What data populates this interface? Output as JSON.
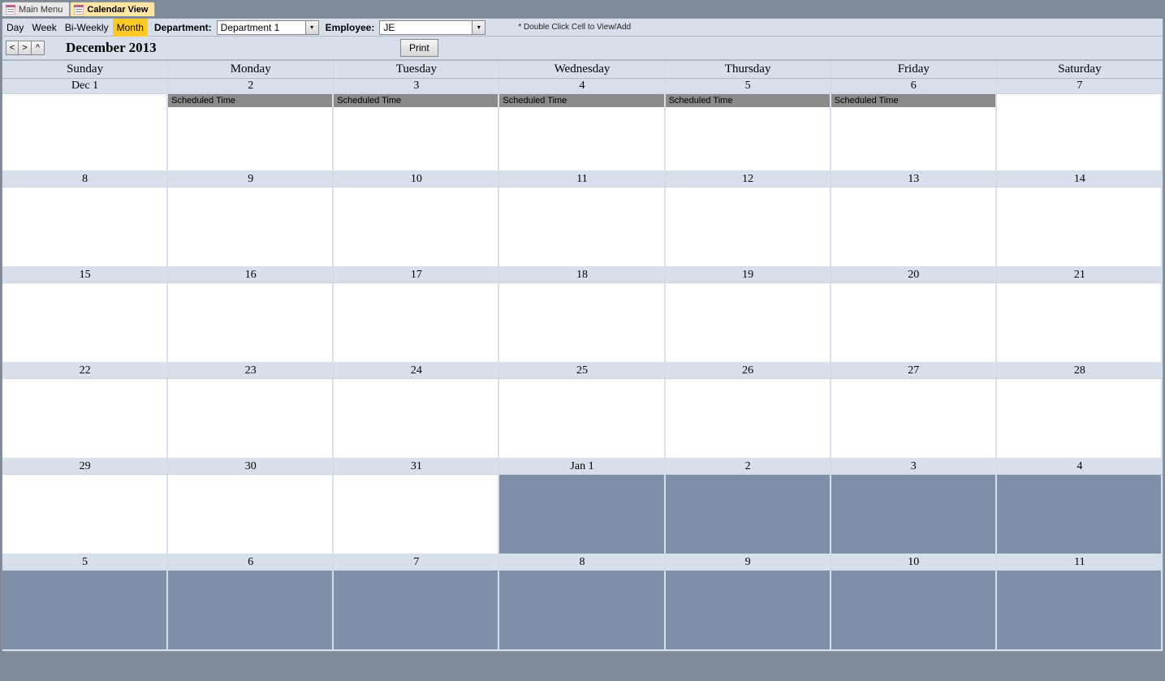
{
  "tabs": [
    {
      "label": "Main Menu",
      "active": false
    },
    {
      "label": "Calendar View",
      "active": true
    }
  ],
  "toolbar": {
    "views": [
      {
        "label": "Day",
        "active": false
      },
      {
        "label": "Week",
        "active": false
      },
      {
        "label": "Bi-Weekly",
        "active": false
      },
      {
        "label": "Month",
        "active": true
      }
    ],
    "department_label": "Department:",
    "department_value": "Department 1",
    "employee_label": "Employee:",
    "employee_value": "JE",
    "hint": "* Double Click Cell to View/Add"
  },
  "nav": {
    "prev": "<",
    "next": ">",
    "up": "^",
    "title": "December 2013",
    "print": "Print"
  },
  "day_names": [
    "Sunday",
    "Monday",
    "Tuesday",
    "Wednesday",
    "Thursday",
    "Friday",
    "Saturday"
  ],
  "weeks": [
    {
      "dates": [
        "Dec 1",
        "2",
        "3",
        "4",
        "5",
        "6",
        "7"
      ],
      "cells": [
        {
          "other": false,
          "events": []
        },
        {
          "other": false,
          "events": [
            "Scheduled Time"
          ]
        },
        {
          "other": false,
          "events": [
            "Scheduled Time"
          ]
        },
        {
          "other": false,
          "events": [
            "Scheduled Time"
          ]
        },
        {
          "other": false,
          "events": [
            "Scheduled Time"
          ]
        },
        {
          "other": false,
          "events": [
            "Scheduled Time"
          ]
        },
        {
          "other": false,
          "events": []
        }
      ]
    },
    {
      "dates": [
        "8",
        "9",
        "10",
        "11",
        "12",
        "13",
        "14"
      ],
      "cells": [
        {
          "other": false,
          "events": []
        },
        {
          "other": false,
          "events": []
        },
        {
          "other": false,
          "events": []
        },
        {
          "other": false,
          "events": []
        },
        {
          "other": false,
          "events": []
        },
        {
          "other": false,
          "events": []
        },
        {
          "other": false,
          "events": []
        }
      ]
    },
    {
      "dates": [
        "15",
        "16",
        "17",
        "18",
        "19",
        "20",
        "21"
      ],
      "cells": [
        {
          "other": false,
          "events": []
        },
        {
          "other": false,
          "events": []
        },
        {
          "other": false,
          "events": []
        },
        {
          "other": false,
          "events": []
        },
        {
          "other": false,
          "events": []
        },
        {
          "other": false,
          "events": []
        },
        {
          "other": false,
          "events": []
        }
      ]
    },
    {
      "dates": [
        "22",
        "23",
        "24",
        "25",
        "26",
        "27",
        "28"
      ],
      "cells": [
        {
          "other": false,
          "events": []
        },
        {
          "other": false,
          "events": []
        },
        {
          "other": false,
          "events": []
        },
        {
          "other": false,
          "events": []
        },
        {
          "other": false,
          "events": []
        },
        {
          "other": false,
          "events": []
        },
        {
          "other": false,
          "events": []
        }
      ]
    },
    {
      "dates": [
        "29",
        "30",
        "31",
        "Jan 1",
        "2",
        "3",
        "4"
      ],
      "cells": [
        {
          "other": false,
          "events": []
        },
        {
          "other": false,
          "events": []
        },
        {
          "other": false,
          "events": []
        },
        {
          "other": true,
          "events": []
        },
        {
          "other": true,
          "events": []
        },
        {
          "other": true,
          "events": []
        },
        {
          "other": true,
          "events": []
        }
      ]
    },
    {
      "dates": [
        "5",
        "6",
        "7",
        "8",
        "9",
        "10",
        "11"
      ],
      "cells": [
        {
          "other": true,
          "events": []
        },
        {
          "other": true,
          "events": []
        },
        {
          "other": true,
          "events": []
        },
        {
          "other": true,
          "events": []
        },
        {
          "other": true,
          "events": []
        },
        {
          "other": true,
          "events": []
        },
        {
          "other": true,
          "events": []
        }
      ]
    }
  ]
}
